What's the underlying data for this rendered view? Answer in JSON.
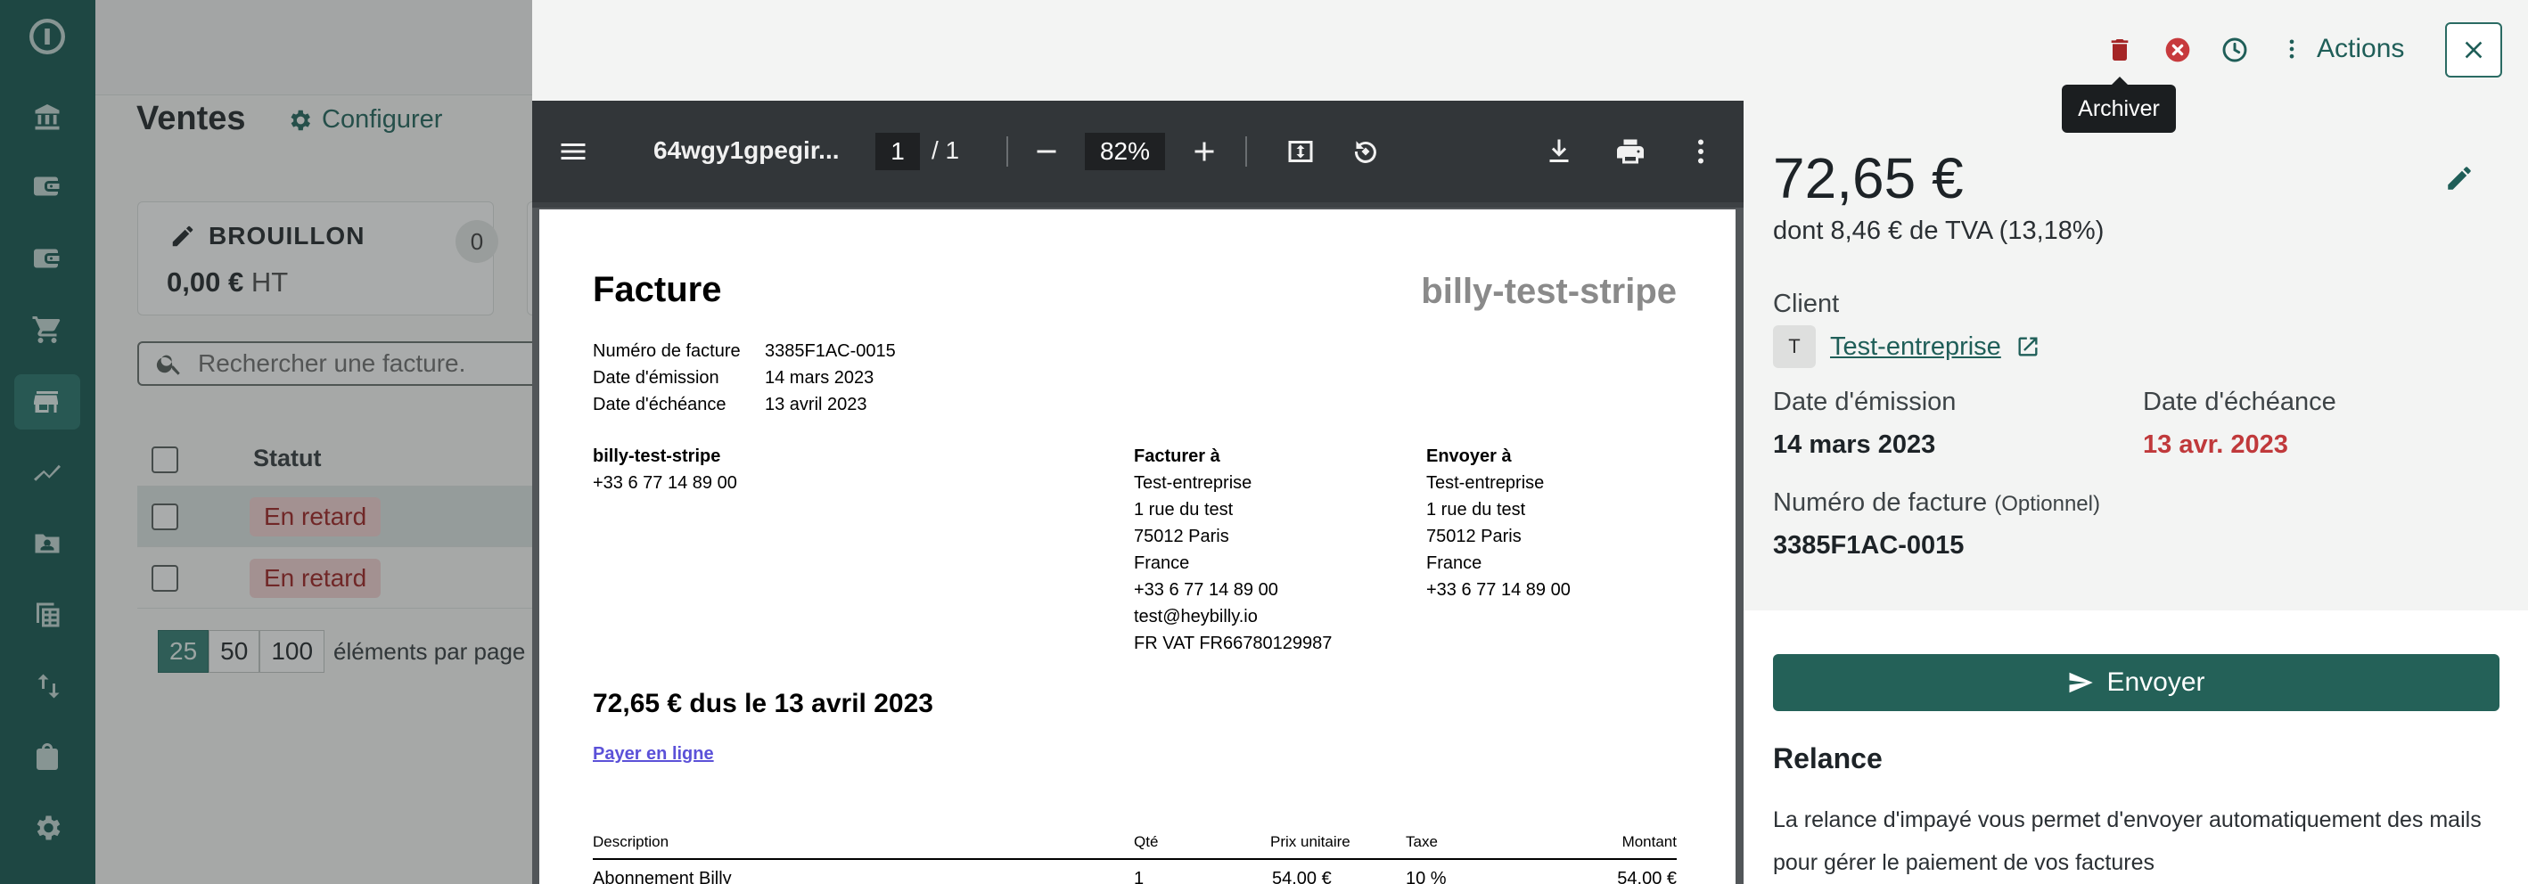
{
  "nav": {
    "items": [
      "logo-icon",
      "bank-icon",
      "wallet-icon",
      "wallet-icon",
      "cart-icon",
      "store-icon",
      "chart-icon",
      "contacts-icon",
      "accounting-icon",
      "transfer-icon",
      "shopping-bag-icon",
      "settings-icon"
    ],
    "active": "store-icon"
  },
  "page": {
    "title": "Ventes",
    "configure_label": "Configurer",
    "draft_card": {
      "label": "BROUILLON",
      "count": "0",
      "amount": "0,00 €",
      "suffix": "HT"
    },
    "search_placeholder": "Rechercher une facture.",
    "table": {
      "header_status": "Statut",
      "rows": [
        {
          "status": "En retard"
        },
        {
          "status": "En retard"
        }
      ]
    },
    "pagination": {
      "options": [
        "25",
        "50",
        "100"
      ],
      "selected": "25",
      "per_page_label": "éléments par page"
    }
  },
  "drawer": {
    "toolbar": {
      "archive_tooltip": "Archiver",
      "actions_label": "Actions"
    },
    "viewer": {
      "file_name": "64wgy1gpegir...",
      "current_page": "1",
      "total_pages": "/  1",
      "zoom": "82%"
    },
    "invoice": {
      "title": "Facture",
      "brand": "billy-test-stripe",
      "meta": [
        {
          "k": "Numéro de facture",
          "v": "3385F1AC-0015"
        },
        {
          "k": "Date d'émission",
          "v": "14 mars 2023"
        },
        {
          "k": "Date d'échéance",
          "v": "13 avril 2023"
        }
      ],
      "seller": {
        "name": "billy-test-stripe",
        "phone": "+33 6 77 14 89 00"
      },
      "bill_to": {
        "heading": "Facturer à",
        "lines": [
          "Test-entreprise",
          "1 rue du test",
          "75012 Paris",
          "France",
          "+33 6 77 14 89 00",
          "test@heybilly.io",
          "FR VAT  FR66780129987"
        ]
      },
      "ship_to": {
        "heading": "Envoyer à",
        "lines": [
          "Test-entreprise",
          "1 rue du test",
          "75012 Paris",
          "France",
          "+33 6 77 14 89 00"
        ]
      },
      "due_line": "72,65 € dus le 13 avril 2023",
      "pay_link": "Payer en ligne",
      "columns": {
        "description": "Description",
        "qty": "Qté",
        "unit_price": "Prix unitaire",
        "tax": "Taxe",
        "amount": "Montant"
      },
      "first_row": {
        "description": "Abonnement Billy",
        "qty": "1",
        "unit_price": "54,00 €",
        "tax": "10 %",
        "amount": "54,00 €"
      }
    },
    "details": {
      "amount": "72,65 €",
      "vat_line": "dont 8,46 € de TVA (13,18%)",
      "client_label": "Client",
      "client_initial": "T",
      "client_name": "Test-entreprise",
      "issue_label": "Date d'émission",
      "issue_value": "14 mars 2023",
      "due_label": "Date d'échéance",
      "due_value": "13 avr. 2023",
      "number_label": "Numéro de facture",
      "number_optional": "(Optionnel)",
      "number_value": "3385F1AC-0015",
      "send_label": "Envoyer",
      "relance_title": "Relance",
      "relance_text": "La relance d'impayé vous permet d'envoyer automatiquement des mails pour gérer le paiement de vos factures"
    },
    "colors": {
      "accent": "#1f5e58",
      "late": "#c0393b",
      "delete": "#a52626"
    }
  }
}
